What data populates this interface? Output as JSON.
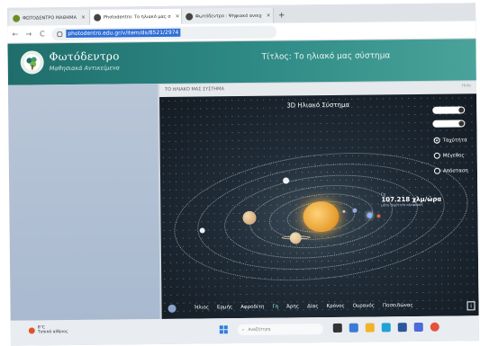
{
  "browser": {
    "tabs": [
      {
        "label": "ΦΩΤΟΔΕΝΤΡΟ ΜΑΘΗΜΑ",
        "close": "×",
        "active": false
      },
      {
        "label": "Photodentro: Το ηλιακό μας σ",
        "close": "×",
        "active": true
      },
      {
        "label": "Φωτόδεντρο : Ψηφιακό ανοιχ",
        "close": "×",
        "active": false
      }
    ],
    "new_tab": "+",
    "url": "photodentro.edu.gr/v/item/ds/8521/2974",
    "nav": {
      "back": "←",
      "forward": "→",
      "reload": "C"
    }
  },
  "site": {
    "brand": "Φωτόδεντρο",
    "tagline": "Μαθησιακά Αντικείμενα",
    "page_title": "Τίτλος: Το ηλιακό μας σύστημα"
  },
  "app": {
    "label": "ΤΟ ΗΛΙΑΚΟ ΜΑΣ ΣΥΣΤΗΜΑ",
    "hide": "Hide",
    "title": "3D Ηλιακό Σύστημα",
    "options": [
      {
        "label": "Ταχύτητα",
        "checked": true
      },
      {
        "label": "Μέγεθος",
        "checked": false
      },
      {
        "label": "Απόσταση",
        "checked": false
      }
    ],
    "planet_label": {
      "name": "Γη",
      "speed": "107.218 χλμ/ώρα",
      "sub": "μέση ταχύτητα περιφοράς"
    },
    "planets": [
      "Ήλιος",
      "Ερμής",
      "Αφροδίτη",
      "Γη",
      "Άρης",
      "Δίας",
      "Κρόνος",
      "Ουρανός",
      "Ποσειδώνας"
    ],
    "selected_planet": "Γη",
    "info": "i"
  },
  "taskbar": {
    "weather_temp": "8°C",
    "weather_desc": "Τοπικά αίθριος",
    "search_placeholder": "Αναζήτηση"
  },
  "colors": {
    "header": "#2f8b86",
    "sun": "#e59b2b",
    "app_bg": "#1f2b36"
  }
}
